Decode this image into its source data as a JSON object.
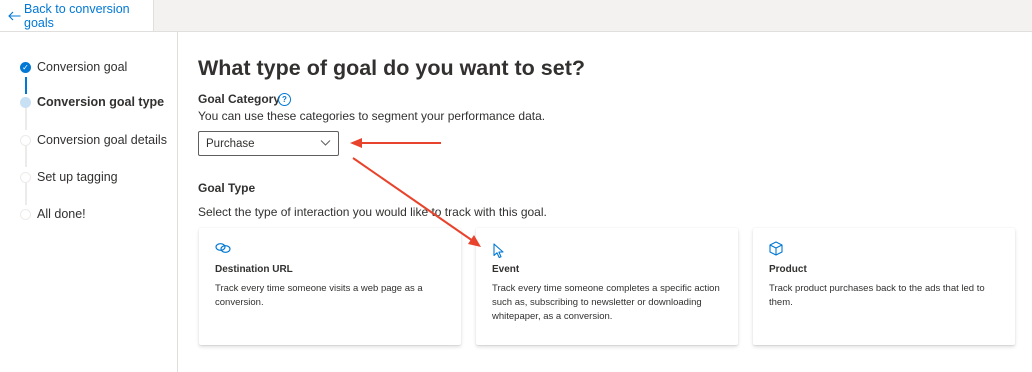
{
  "header": {
    "back_label": "Back to conversion goals"
  },
  "sidebar": {
    "steps": [
      {
        "label": "Conversion goal",
        "state": "done"
      },
      {
        "label": "Conversion goal type",
        "state": "current"
      },
      {
        "label": "Conversion goal details",
        "state": "todo"
      },
      {
        "label": "Set up tagging",
        "state": "todo"
      },
      {
        "label": "All done!",
        "state": "todo"
      }
    ]
  },
  "main": {
    "title": "What type of goal do you want to set?",
    "category_label": "Goal Category",
    "category_help": "?",
    "category_desc": "You can use these categories to segment your performance data.",
    "category_value": "Purchase",
    "type_label": "Goal Type",
    "type_desc": "Select the type of interaction you would like to track with this goal.",
    "cards": [
      {
        "icon": "link-icon",
        "title": "Destination URL",
        "desc_lines": [
          "Track every time someone visits a web page as a",
          "conversion."
        ]
      },
      {
        "icon": "cursor-icon",
        "title": "Event",
        "desc_lines": [
          "Track every time someone completes a specific action",
          "such as, subscribing to newsletter or downloading",
          "whitepaper, as a conversion."
        ]
      },
      {
        "icon": "box-icon",
        "title": "Product",
        "desc_lines": [
          "Track product purchases back to the ads that led to",
          "them."
        ]
      }
    ]
  },
  "colors": {
    "accent": "#0078d4",
    "annotation_arrow": "#e8432c"
  }
}
